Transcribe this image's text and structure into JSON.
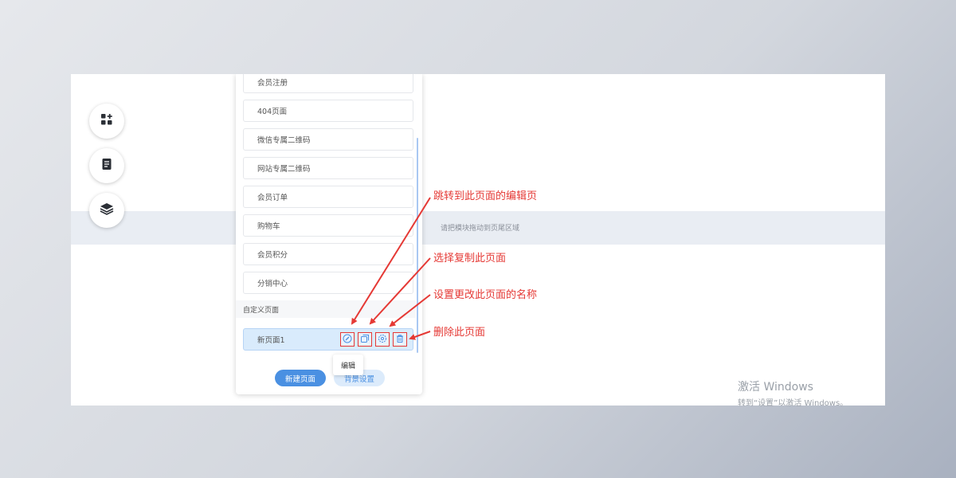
{
  "editor": {
    "footer_hint": "请把模块拖动到页尾区域",
    "tools": [
      {
        "icon": "add-module-icon"
      },
      {
        "icon": "page-list-icon"
      },
      {
        "icon": "layers-icon"
      }
    ]
  },
  "panel": {
    "pages": [
      "会员注册",
      "404页面",
      "微信专属二维码",
      "网站专属二维码",
      "会员订单",
      "购物车",
      "会员积分",
      "分销中心"
    ],
    "custom_section_label": "自定义页面",
    "custom_pages": [
      {
        "label": "新页面1"
      }
    ],
    "actions": [
      {
        "icon": "edit-icon"
      },
      {
        "icon": "copy-icon"
      },
      {
        "icon": "settings-icon"
      },
      {
        "icon": "trash-icon"
      }
    ],
    "tooltip": "编辑",
    "new_page_label": "新建页面",
    "bg_setting_label": "背景设置"
  },
  "annotations": {
    "edit": "跳转到此页面的编辑页",
    "copy": "选择复制此页面",
    "rename": "设置更改此页面的名称",
    "delete": "删除此页面"
  },
  "colors": {
    "accent": "#4a90e2",
    "annotation": "#e53935"
  },
  "watermark": {
    "title": "激活 Windows",
    "subtitle": "转到“设置”以激活 Windows。"
  }
}
